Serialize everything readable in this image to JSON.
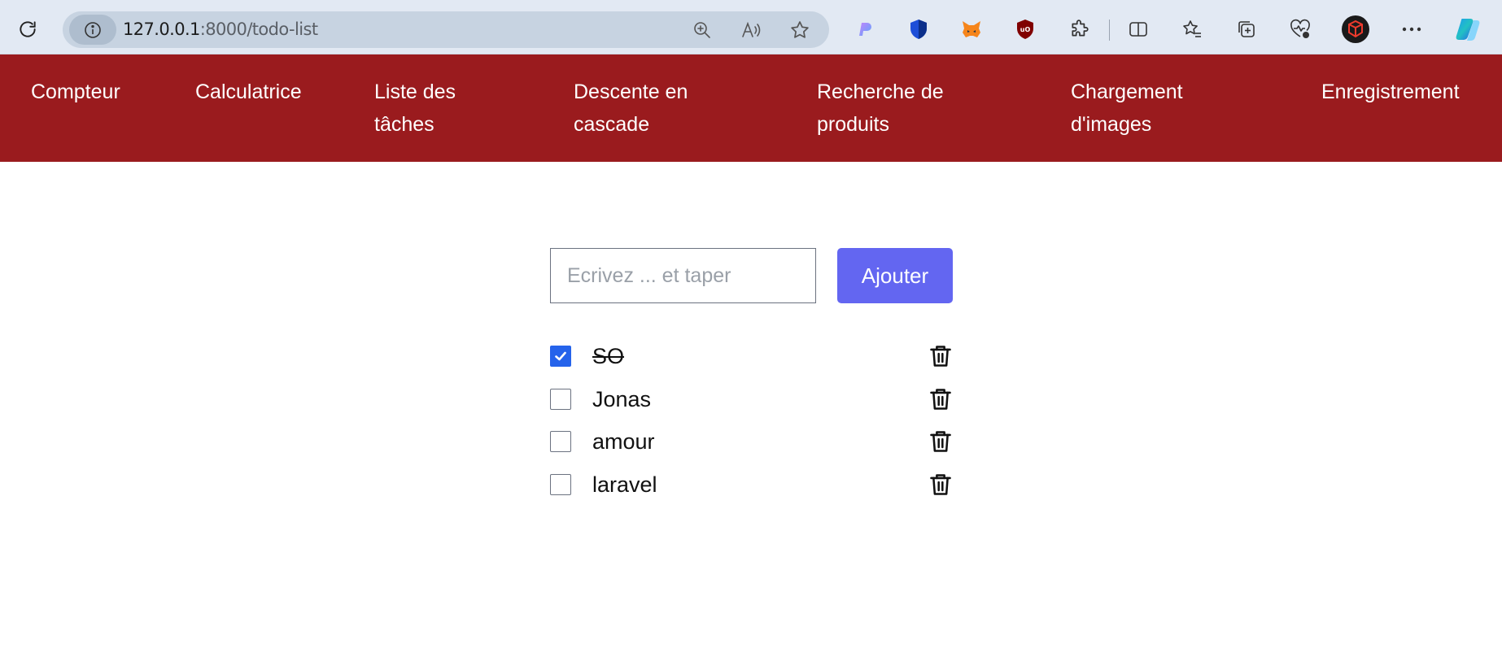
{
  "browser": {
    "url_host": "127.0.0.1",
    "url_path": ":8000/todo-list"
  },
  "nav": {
    "items": [
      {
        "line1": "Compteur",
        "line2": ""
      },
      {
        "line1": "Calculatrice",
        "line2": ""
      },
      {
        "line1": "Liste des",
        "line2": "tâches"
      },
      {
        "line1": "Descente en",
        "line2": "cascade"
      },
      {
        "line1": "Recherche de",
        "line2": "produits"
      },
      {
        "line1": "Chargement",
        "line2": "d'images"
      },
      {
        "line1": "Enregistrement",
        "line2": ""
      }
    ]
  },
  "form": {
    "input_value": "",
    "input_placeholder": "Ecrivez ... et taper",
    "add_label": "Ajouter"
  },
  "todos": [
    {
      "text": "SO",
      "done": true
    },
    {
      "text": "Jonas",
      "done": false
    },
    {
      "text": "amour",
      "done": false
    },
    {
      "text": "laravel",
      "done": false
    }
  ],
  "colors": {
    "navbar": "#9a1b1e",
    "accent_button": "#6366f1",
    "checkbox_checked": "#2563eb"
  }
}
